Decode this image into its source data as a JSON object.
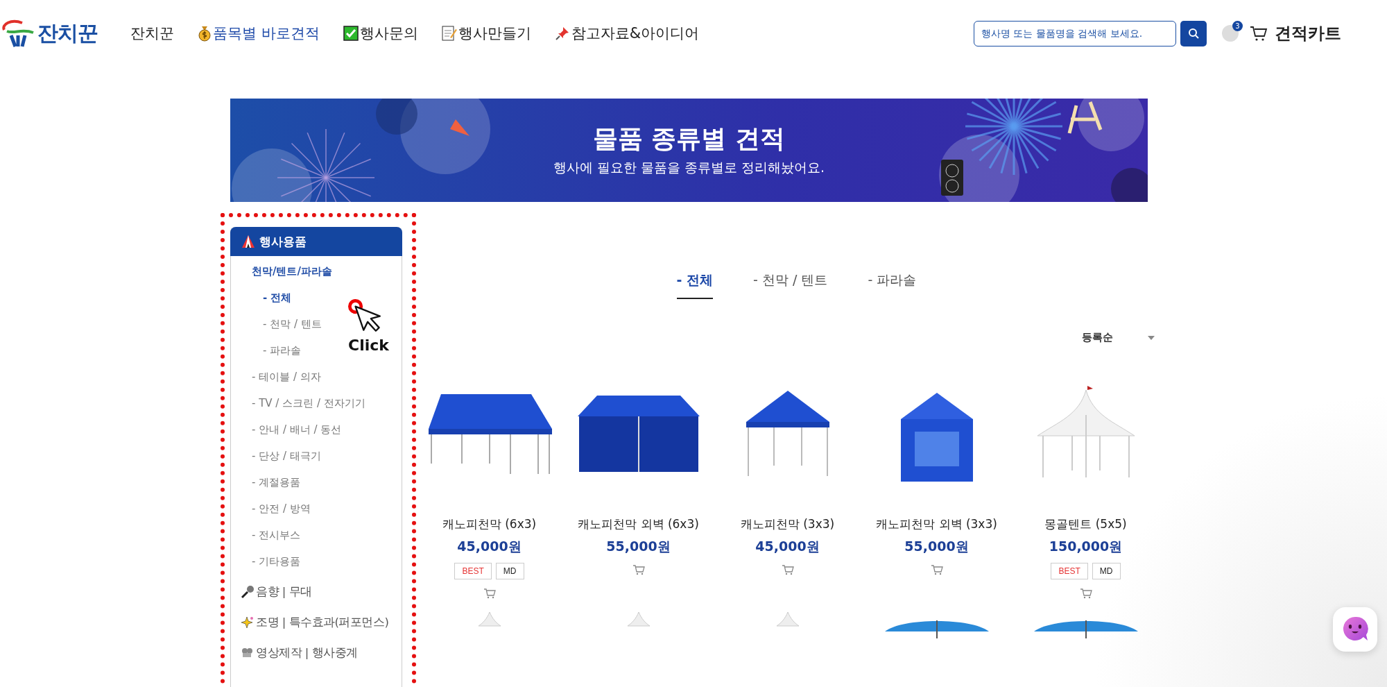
{
  "header": {
    "logo": "잔치꾼",
    "nav": [
      {
        "label": "잔치꾼",
        "selected": false
      },
      {
        "label": "품목별 바로견적",
        "selected": true
      },
      {
        "label": "행사문의",
        "selected": false
      },
      {
        "label": "행사만들기",
        "selected": false
      },
      {
        "label": "참고자료&아이디어",
        "selected": false
      }
    ],
    "search": {
      "placeholder": "행사명 또는 물품명을 검색해 보세요."
    },
    "cart_count": "3",
    "cart_label": "견적카트"
  },
  "banner": {
    "title": "물품 종류별 견적",
    "subtitle": "행사에 필요한 물품을 종류별로 정리해놨어요."
  },
  "sidebar": {
    "categories": [
      {
        "label": "행사용품",
        "expanded": true,
        "children": [
          {
            "label": "천막/텐트/파라솔",
            "selected": true,
            "children": [
              {
                "label": "- 전체",
                "selected": true
              },
              {
                "label": "- 천막 / 텐트",
                "selected": false
              },
              {
                "label": "- 파라솔",
                "selected": false
              }
            ]
          },
          {
            "label": "- 테이블 / 의자",
            "selected": false
          },
          {
            "label": "- TV / 스크린 / 전자기기",
            "selected": false
          },
          {
            "label": "- 안내 / 배너 / 동선",
            "selected": false
          },
          {
            "label": "- 단상 / 태극기",
            "selected": false
          },
          {
            "label": "- 계절용품",
            "selected": false
          },
          {
            "label": "- 안전 / 방역",
            "selected": false
          },
          {
            "label": "- 전시부스",
            "selected": false
          },
          {
            "label": "- 기타용품",
            "selected": false
          }
        ]
      },
      {
        "label": "음향 | 무대",
        "expanded": false
      },
      {
        "label": "조명 | 특수효과(퍼포먼스)",
        "expanded": false
      },
      {
        "label": "영상제작 | 행사중계",
        "expanded": false
      }
    ]
  },
  "annotation": {
    "label": "Click"
  },
  "tabs": [
    {
      "label": "- 전체",
      "selected": true
    },
    {
      "label": "- 천막 / 텐트",
      "selected": false
    },
    {
      "label": "- 파라솔",
      "selected": false
    }
  ],
  "sort": {
    "value": "등록순"
  },
  "products": [
    {
      "kind": "card",
      "name": "캐노피천막 (6x3)",
      "price": "45,000원",
      "badges": [
        {
          "label": "BEST",
          "kind": "best"
        },
        {
          "label": "MD",
          "kind": "md"
        }
      ]
    },
    {
      "kind": "card",
      "name": "캐노피천막 외벽 (6x3)",
      "price": "55,000원"
    },
    {
      "kind": "card",
      "name": "캐노피천막 (3x3)",
      "price": "45,000원"
    },
    {
      "kind": "card",
      "name": "캐노피천막 외벽 (3x3)",
      "price": "55,000원"
    },
    {
      "kind": "card",
      "name": "몽골텐트 (5x5)",
      "price": "150,000원",
      "badges": [
        {
          "label": "BEST",
          "kind": "best"
        },
        {
          "label": "MD",
          "kind": "md"
        }
      ]
    },
    {
      "kind": "partial"
    },
    {
      "kind": "partial"
    },
    {
      "kind": "partial"
    },
    {
      "kind": "partial"
    },
    {
      "kind": "partial"
    }
  ]
}
